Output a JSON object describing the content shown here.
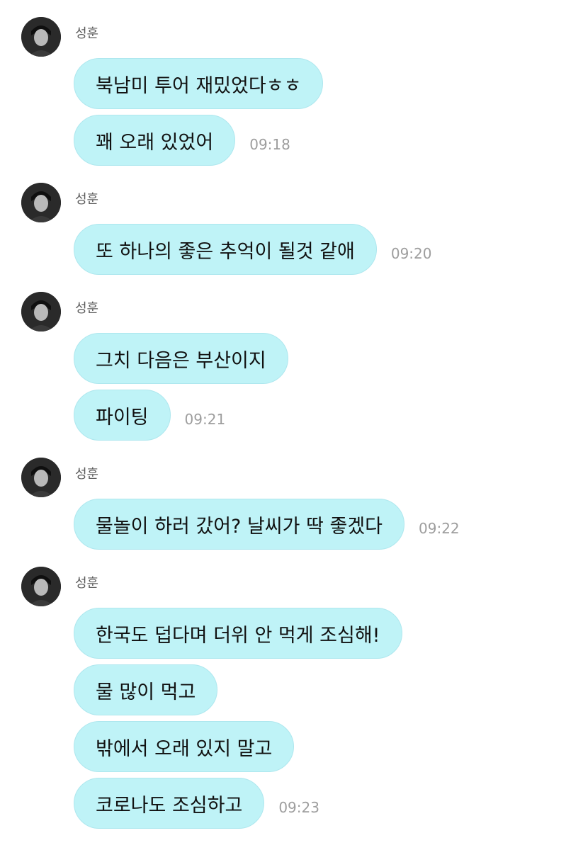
{
  "chat": {
    "groups": [
      {
        "sender": "성훈",
        "messages": [
          {
            "text": "북남미 투어 재밌었다ㅎㅎ",
            "time": ""
          },
          {
            "text": "꽤 오래 있었어",
            "time": "09:18"
          }
        ]
      },
      {
        "sender": "성훈",
        "messages": [
          {
            "text": "또 하나의 좋은 추억이 될것 같애",
            "time": "09:20"
          }
        ]
      },
      {
        "sender": "성훈",
        "messages": [
          {
            "text": "그치 다음은 부산이지",
            "time": ""
          },
          {
            "text": "파이팅",
            "time": "09:21"
          }
        ]
      },
      {
        "sender": "성훈",
        "messages": [
          {
            "text": "물놀이 하러 갔어? 날씨가 딱 좋겠다",
            "time": "09:22"
          }
        ]
      },
      {
        "sender": "성훈",
        "messages": [
          {
            "text": "한국도 덥다며 더위 안 먹게 조심해!",
            "time": ""
          },
          {
            "text": "물 많이 먹고",
            "time": ""
          },
          {
            "text": "밖에서 오래 있지 말고",
            "time": ""
          },
          {
            "text": "코로나도 조심하고",
            "time": "09:23"
          }
        ]
      }
    ]
  },
  "colors": {
    "bubble": "#bff3f7",
    "bubble_border": "#aee7ee",
    "time": "#9d9d9d",
    "sender": "#5c5c5c"
  },
  "icons": {
    "avatar": "profile-photo"
  }
}
